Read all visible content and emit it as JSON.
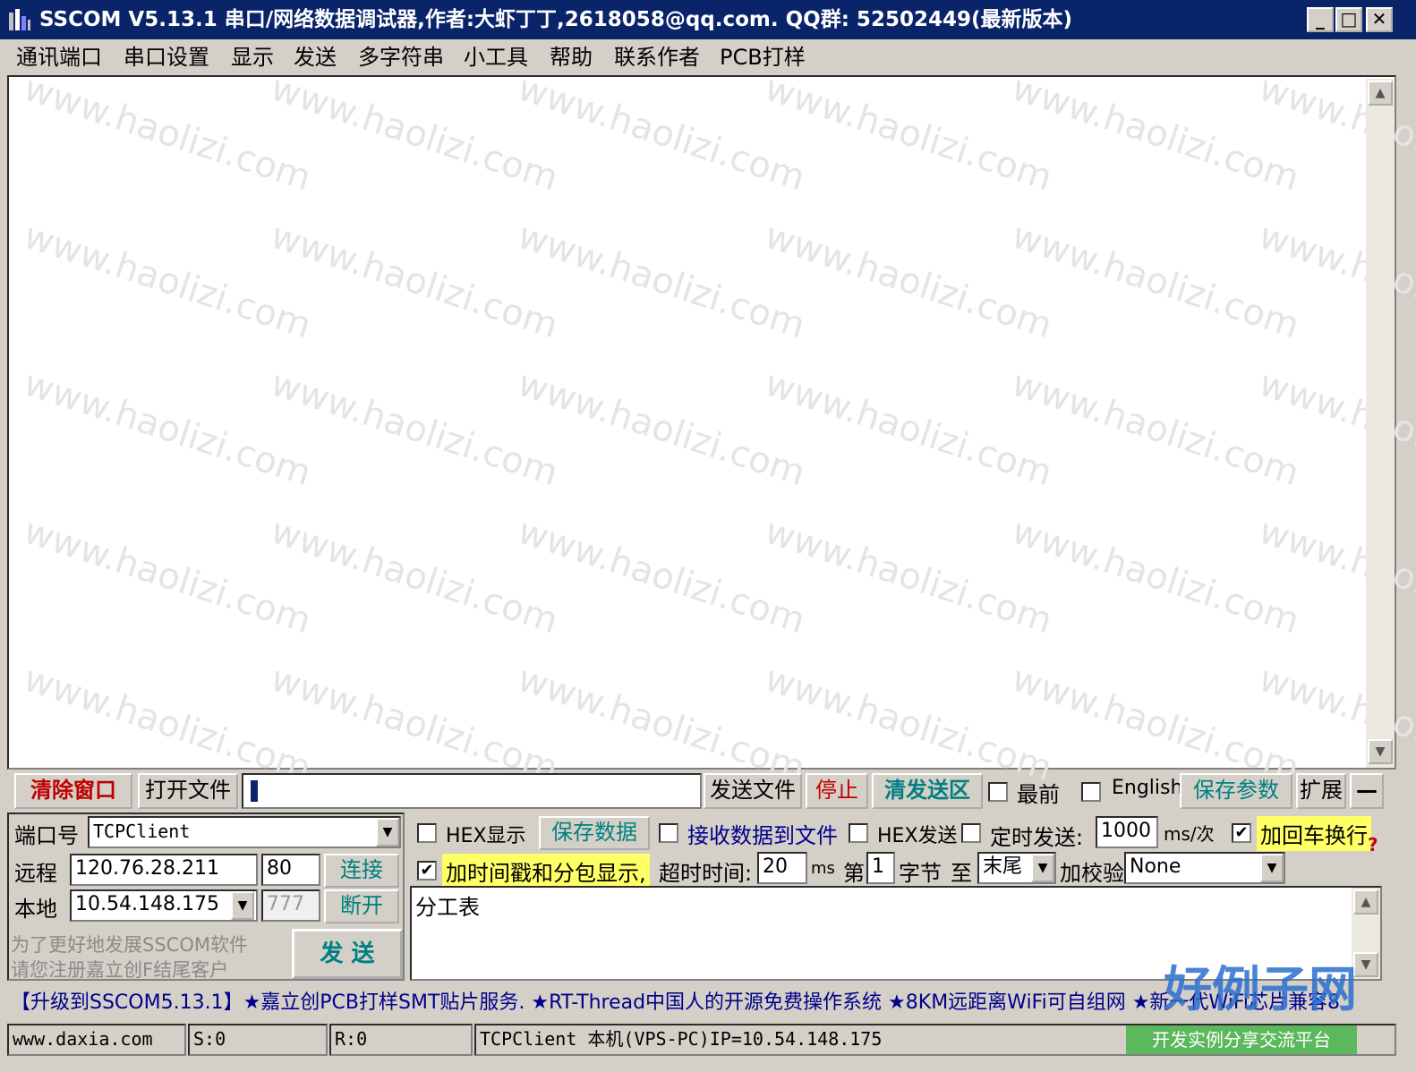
{
  "window": {
    "title": "SSCOM V5.13.1 串口/网络数据调试器,作者:大虾丁丁,2618058@qq.com. QQ群: 52502449(最新版本)",
    "minimize": "_",
    "maximize": "□",
    "close": "✕"
  },
  "menu": [
    "通讯端口",
    "串口设置",
    "显示",
    "发送",
    "多字符串",
    "小工具",
    "帮助",
    "联系作者",
    "PCB打样"
  ],
  "toolbar": {
    "clear_window": "清除窗口",
    "open_file": "打开文件",
    "send_file": "发送文件",
    "stop": "停止",
    "clear_send": "清发送区",
    "topmost": "最前",
    "english": "English",
    "save_params": "保存参数",
    "expand": "扩展",
    "collapse": "—"
  },
  "connection": {
    "port_label": "端口号",
    "port_value": "TCPClient",
    "remote_label": "远程",
    "remote_ip": "120.76.28.211",
    "remote_port": "80",
    "connect": "连接",
    "local_label": "本地",
    "local_ip": "10.54.148.175",
    "local_port": "777",
    "disconnect": "断开",
    "promo_line1": "为了更好地发展SSCOM软件",
    "promo_line2": "请您注册嘉立创F结尾客户",
    "send": "发 送"
  },
  "options": {
    "hex_display": "HEX显示",
    "save_data": "保存数据",
    "recv_to_file": "接收数据到文件",
    "hex_send": "HEX发送",
    "timed_send": "定时发送:",
    "interval": "1000",
    "interval_unit": "ms/次",
    "add_crlf": "加回车换行",
    "add_timestamp": "加时间戳和分包显示,",
    "timeout_label": "超时时间:",
    "timeout_value": "20",
    "timeout_unit": "ms",
    "byte_prefix": "第",
    "byte_index": "1",
    "byte_suffix": "字节",
    "to_label": "至",
    "to_value": "末尾",
    "checksum_label": "加校验",
    "checksum_value": "None",
    "help_icon": "?"
  },
  "send_text": "分工表",
  "ticker": "【升级到SSCOM5.13.1】★嘉立创PCB打样SMT贴片服务. ★RT-Thread中国人的开源免费操作系统 ★8KM远距离WiFi可自组网 ★新一代WiFi芯片兼容8",
  "status": {
    "website": "www.daxia.com",
    "sent": "S:0",
    "received": "R:0",
    "info": "TCPClient 本机(VPS-PC)IP=10.54.148.175"
  },
  "watermark": {
    "text": "www.haolizi.com",
    "logo_title": "好例子网",
    "logo_subtitle": "开发实例分享交流平台"
  }
}
